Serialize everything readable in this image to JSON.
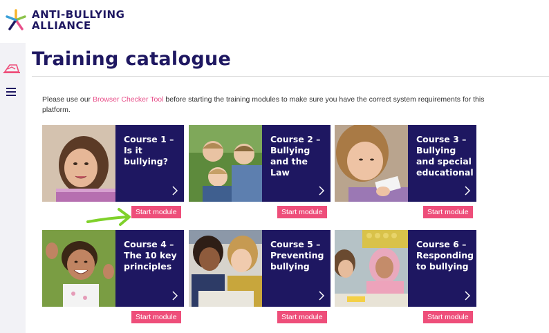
{
  "brand": {
    "line1": "ANTI-BULLYING",
    "line2": "ALLIANCE",
    "colors": {
      "navy": "#1e1761",
      "pink": "#ee4e7a",
      "link": "#e8508a"
    }
  },
  "sidebar": {
    "icons": [
      "training-icon",
      "menu-icon"
    ]
  },
  "page": {
    "title": "Training catalogue",
    "intro_before": "Please use our ",
    "intro_link": "Browser Checker Tool",
    "intro_after": " before starting the training modules to make sure you have the correct system requirements for this platform."
  },
  "courses": [
    {
      "title": "Course 1 – Is it bullying?",
      "button": "Start module"
    },
    {
      "title": "Course 2 – Bullying and the Law",
      "button": "Start module"
    },
    {
      "title": "Course 3 – Bullying and special educational",
      "button": "Start module"
    },
    {
      "title": "Course 4 – The 10 key principles",
      "button": "Start module"
    },
    {
      "title": "Course 5 – Preventing bullying",
      "button": "Start module"
    },
    {
      "title": "Course 6 – Responding to bullying",
      "button": "Start module"
    }
  ]
}
